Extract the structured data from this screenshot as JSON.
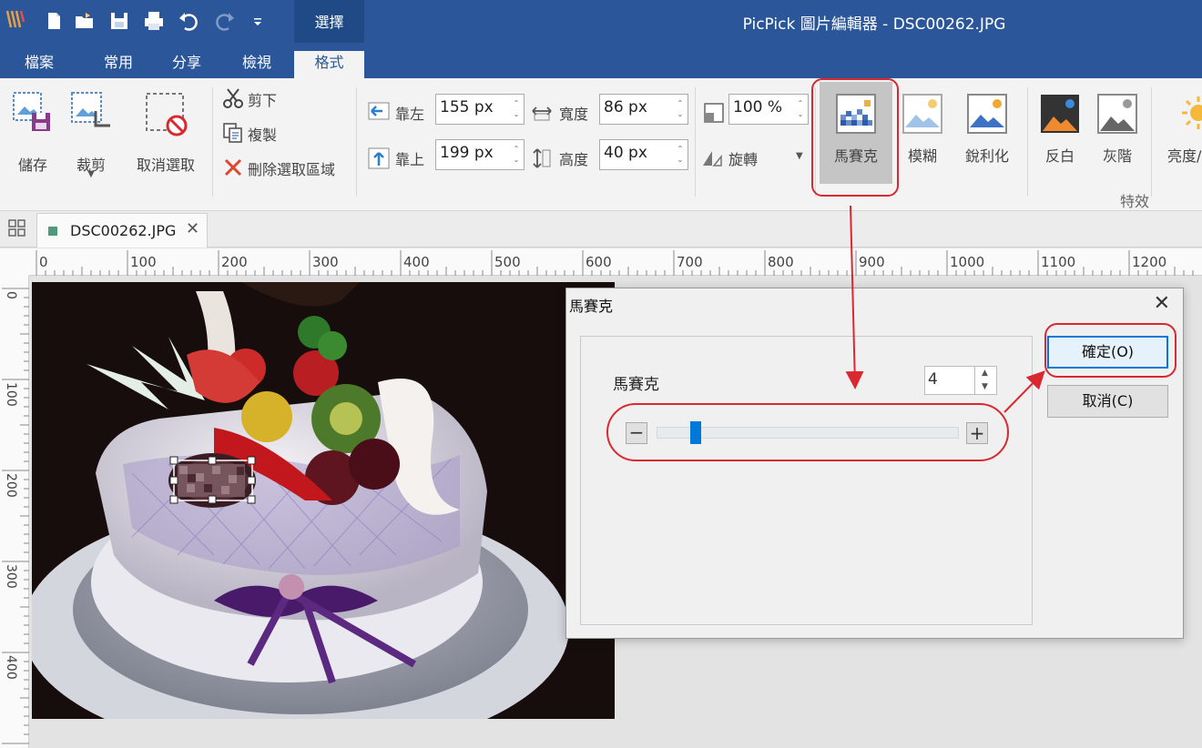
{
  "window": {
    "title": "PicPick 圖片編輯器 - DSC00262.JPG",
    "contextual_tab": "選擇"
  },
  "ribbon_tabs": [
    "檔案",
    "常用",
    "分享",
    "檢視",
    "格式"
  ],
  "ribbon": {
    "save": "儲存",
    "crop": "裁剪",
    "deselect": "取消選取",
    "cut": "剪下",
    "copy": "複製",
    "delete_selection": "刪除選取區域",
    "left_label": "靠左",
    "left_value": "155 px",
    "top_label": "靠上",
    "top_value": "199 px",
    "width_label": "寬度",
    "width_value": "86 px",
    "height_label": "高度",
    "height_value": "40 px",
    "zoom_value": "100 %",
    "rotate": "旋轉",
    "mosaic": "馬賽克",
    "blur": "模糊",
    "sharpen": "銳利化",
    "invert": "反白",
    "grayscale": "灰階",
    "brightness": "亮度/",
    "effects_group": "特效"
  },
  "document_tab": {
    "name": "DSC00262.JPG"
  },
  "ruler": {
    "h_labels": [
      "0",
      "100",
      "200",
      "300",
      "400",
      "500",
      "600",
      "700",
      "800",
      "900",
      "1000",
      "1100",
      "1200"
    ],
    "v_labels": [
      "0",
      "100",
      "200",
      "300",
      "400"
    ]
  },
  "dialog": {
    "title": "馬賽克",
    "label": "馬賽克",
    "value": "4",
    "slider_fraction": 0.05,
    "ok": "確定(O)",
    "cancel": "取消(C)"
  },
  "colors": {
    "titlebar": "#2b579a",
    "annotation_red": "#d9282f",
    "accent": "#0078d7"
  }
}
